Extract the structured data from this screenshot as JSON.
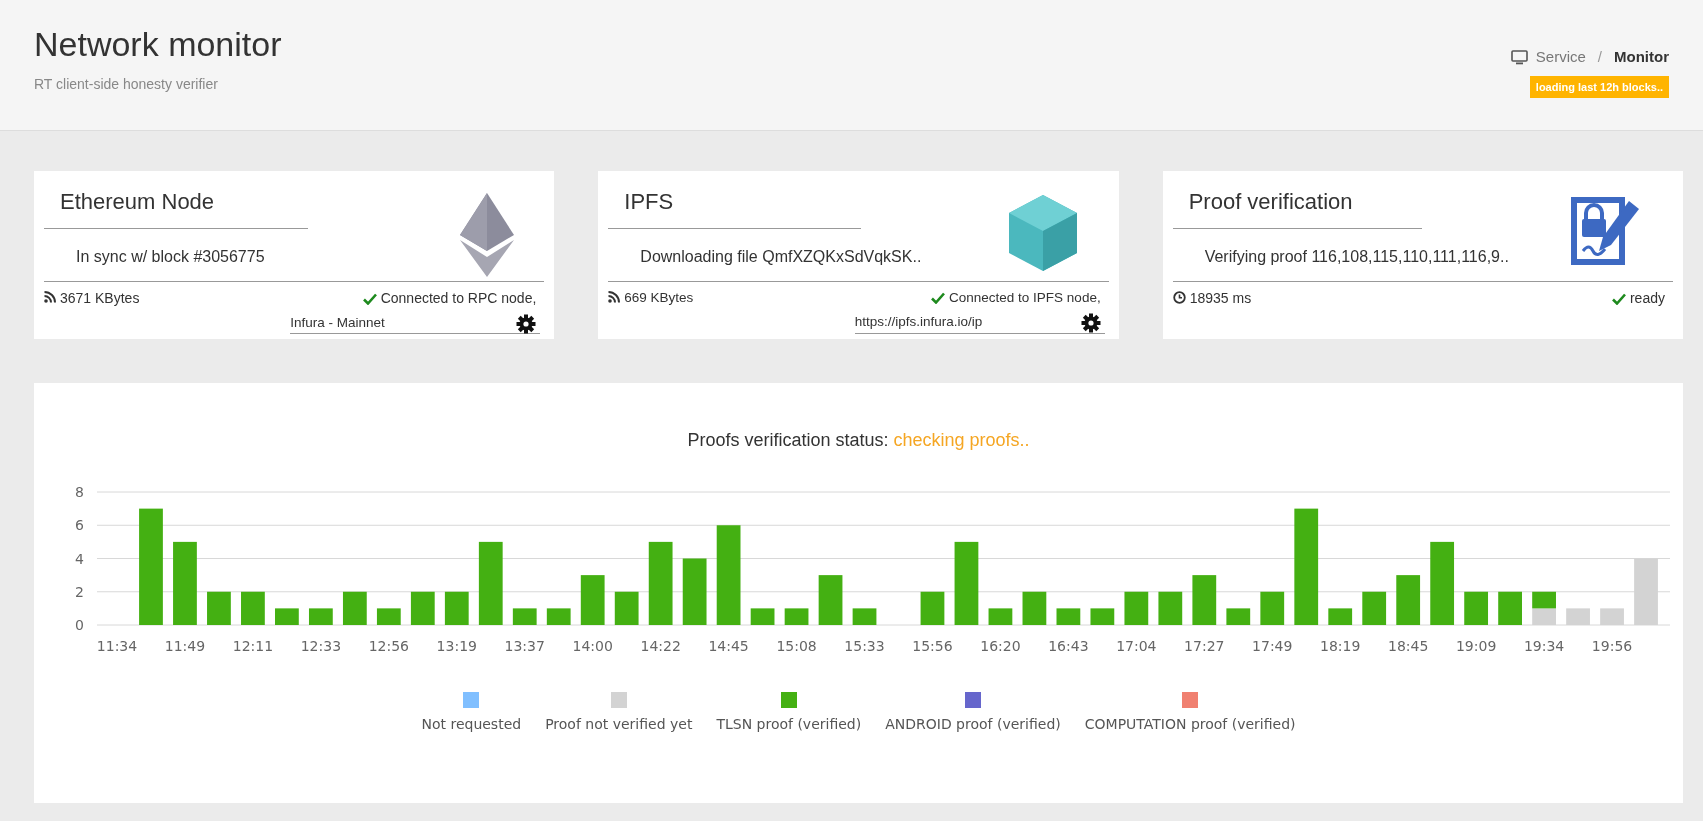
{
  "header": {
    "title": "Network monitor",
    "subtitle": "RT client-side honesty verifier",
    "breadcrumb": [
      {
        "label": "Service",
        "active": false
      },
      {
        "label": "Monitor",
        "active": true
      }
    ],
    "separator": "/",
    "badge": "loading last 12h blocks.."
  },
  "cards": [
    {
      "kind": "ethereum",
      "title": "Ethereum Node",
      "message": "In sync w/ block #3056775",
      "size": "3671 KBytes",
      "status": "Connected to RPC node,",
      "endpoint": "Infura - Mainnet"
    },
    {
      "kind": "ipfs",
      "title": "IPFS",
      "message": "Downloading file QmfXZQKxSdVqkSK..",
      "size": "669 KBytes",
      "status": "Connected to IPFS node,",
      "endpoint": "https://ipfs.infura.io/ip"
    },
    {
      "kind": "proof",
      "title": "Proof verification",
      "message": "Verifying proof 116,108,115,110,111,116,9..",
      "size": "18935 ms",
      "status": "ready"
    }
  ],
  "chart": {
    "status": "checking proofs..",
    "chart_data": {
      "type": "bar",
      "title": "Proofs verification status:",
      "stacked": true,
      "categories": [
        "11:34",
        null,
        "11:49",
        null,
        "12:11",
        null,
        "12:33",
        null,
        "12:56",
        null,
        "13:19",
        null,
        "13:37",
        null,
        "14:00",
        null,
        "14:22",
        null,
        "14:45",
        null,
        "15:08",
        null,
        "15:33",
        null,
        "15:56",
        null,
        "16:20",
        null,
        "16:43",
        null,
        "17:04",
        null,
        "17:27",
        null,
        "17:49",
        null,
        "18:19",
        null,
        "18:45",
        null,
        "19:09",
        null,
        "19:34",
        null,
        "19:56",
        null
      ],
      "grid": true,
      "ylim": [
        0,
        8
      ],
      "yticks": [
        0,
        2,
        4,
        6,
        8
      ],
      "series": [
        {
          "name": "Not requested",
          "color": "#80bfff",
          "values": [
            0,
            0,
            0,
            0,
            0,
            0,
            0,
            0,
            0,
            0,
            0,
            0,
            0,
            0,
            0,
            0,
            0,
            0,
            0,
            0,
            0,
            0,
            0,
            0,
            0,
            0,
            0,
            0,
            0,
            0,
            0,
            0,
            0,
            0,
            0,
            0,
            0,
            0,
            0,
            0,
            0,
            0,
            0,
            0,
            0,
            0
          ]
        },
        {
          "name": "Proof not verified yet",
          "color": "#d3d3d3",
          "values": [
            0,
            0,
            0,
            0,
            0,
            0,
            0,
            0,
            0,
            0,
            0,
            0,
            0,
            0,
            0,
            0,
            0,
            0,
            0,
            0,
            0,
            0,
            0,
            0,
            0,
            0,
            0,
            0,
            0,
            0,
            0,
            0,
            0,
            0,
            0,
            0,
            0,
            0,
            0,
            0,
            0,
            0,
            1,
            1,
            1,
            4
          ]
        },
        {
          "name": "TLSN proof (verified)",
          "color": "#44b012",
          "values": [
            0,
            7,
            5,
            2,
            2,
            1,
            1,
            2,
            1,
            2,
            2,
            5,
            1,
            1,
            3,
            2,
            5,
            4,
            6,
            1,
            1,
            3,
            1,
            0,
            2,
            5,
            1,
            2,
            1,
            1,
            2,
            2,
            3,
            1,
            2,
            7,
            1,
            2,
            3,
            5,
            2,
            2,
            1,
            0,
            0,
            0
          ]
        },
        {
          "name": "ANDROID proof (verified)",
          "color": "#6666cc",
          "values": [
            0,
            0,
            0,
            0,
            0,
            0,
            0,
            0,
            0,
            0,
            0,
            0,
            0,
            0,
            0,
            0,
            0,
            0,
            0,
            0,
            0,
            0,
            0,
            0,
            0,
            0,
            0,
            0,
            0,
            0,
            0,
            0,
            0,
            0,
            0,
            0,
            0,
            0,
            0,
            0,
            0,
            0,
            0,
            0,
            0,
            0
          ]
        },
        {
          "name": "COMPUTATION proof (verified)",
          "color": "#f08070",
          "values": [
            0,
            0,
            0,
            0,
            0,
            0,
            0,
            0,
            0,
            0,
            0,
            0,
            0,
            0,
            0,
            0,
            0,
            0,
            0,
            0,
            0,
            0,
            0,
            0,
            0,
            0,
            0,
            0,
            0,
            0,
            0,
            0,
            0,
            0,
            0,
            0,
            0,
            0,
            0,
            0,
            0,
            0,
            0,
            0,
            0,
            0
          ]
        }
      ]
    }
  }
}
